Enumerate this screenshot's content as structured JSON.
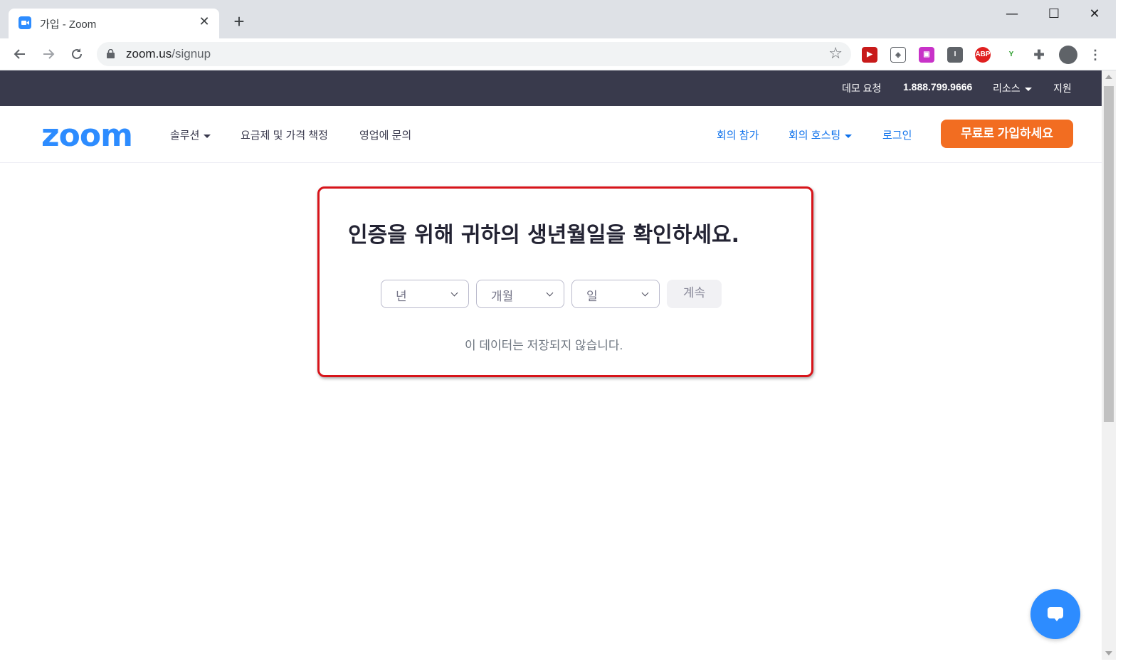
{
  "browser": {
    "tab_title": "가입 - Zoom",
    "tab_close": "✕",
    "new_tab": "+",
    "url_host": "zoom.us",
    "url_path": "/signup",
    "win_minimize": "—",
    "win_maximize": "☐",
    "win_close": "✕",
    "extensions": [
      "ABP"
    ]
  },
  "topbar": {
    "demo": "데모 요청",
    "phone": "1.888.799.9666",
    "resources": "리소스",
    "support": "지원"
  },
  "nav": {
    "logo": "zoom",
    "solutions": "솔루션",
    "pricing": "요금제 및 가격 책정",
    "sales": "영업에 문의",
    "join": "회의 참가",
    "host": "회의 호스팅",
    "signin": "로그인",
    "signup": "무료로 가입하세요"
  },
  "main": {
    "heading": "인증을 위해 귀하의 생년월일을 확인하세요.",
    "year_placeholder": "년",
    "month_placeholder": "개월",
    "day_placeholder": "일",
    "continue": "계속",
    "note": "이 데이터는 저장되지 않습니다."
  },
  "colors": {
    "topbar_bg": "#393a4c",
    "brand_blue": "#2d8cff",
    "link_blue": "#0e71eb",
    "signup_orange": "#f26d21",
    "highlight_red": "#d7141a"
  }
}
